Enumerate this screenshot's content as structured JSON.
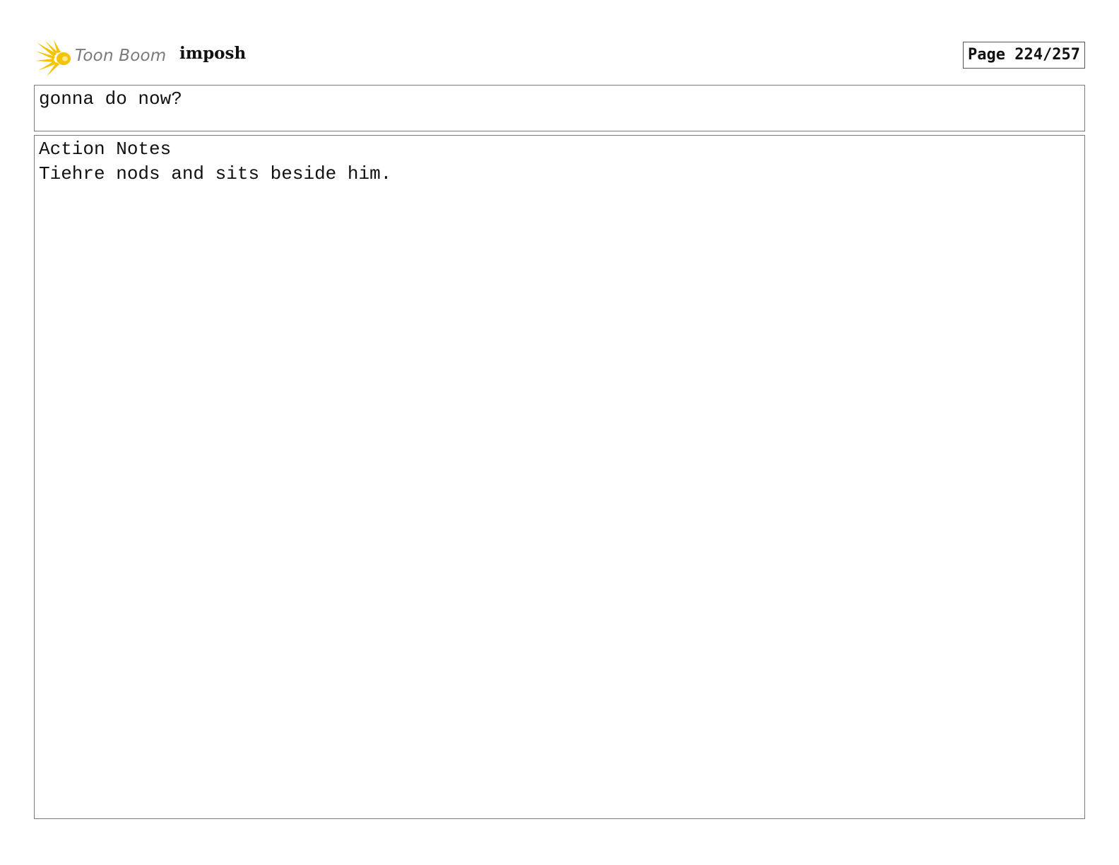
{
  "header": {
    "logo_text": "Toon Boom",
    "project_title": "imposh",
    "page_label": "Page 224/257"
  },
  "dialogue": {
    "text": "gonna do now?"
  },
  "action_notes": {
    "label": "Action Notes",
    "text": "Tiehre nods and sits beside him."
  },
  "colors": {
    "logo_yellow": "#f5c400",
    "logo_gray": "#7a7a7a",
    "border": "#7a7a7a"
  },
  "icons": [
    "toon-boom-logo-icon"
  ]
}
